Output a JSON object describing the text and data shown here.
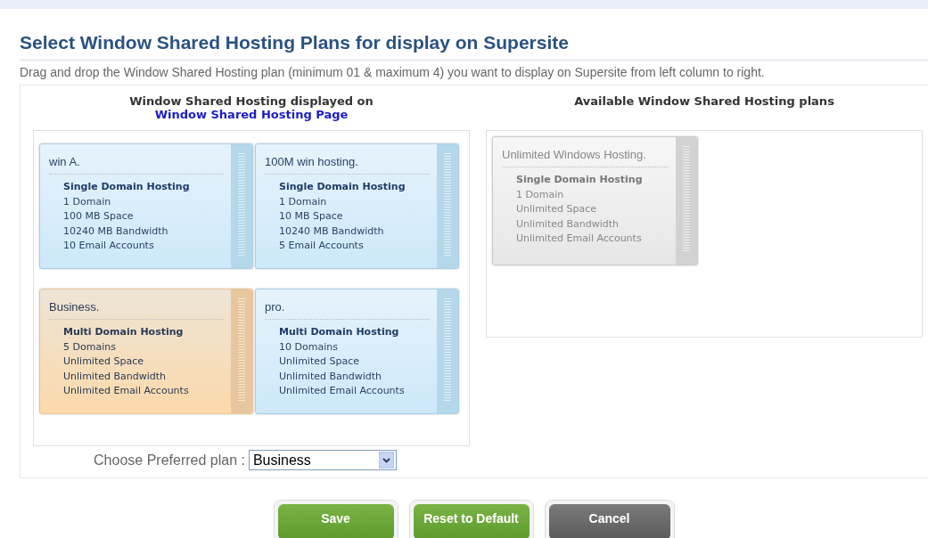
{
  "title": "Select Window Shared Hosting Plans for display on Supersite",
  "description": "Drag and drop the Window Shared Hosting plan (minimum 01 & maximum 4) you want to display on Supersite from left column to right.",
  "displayed": {
    "heading": "Window Shared Hosting displayed on",
    "heading_link": "Window Shared Hosting Page",
    "plans": [
      {
        "name": "win A.",
        "selected": false,
        "features": [
          "Single Domain Hosting",
          "1 Domain",
          "100 MB Space",
          "10240 MB Bandwidth",
          "10 Email Accounts"
        ]
      },
      {
        "name": "100M win hosting.",
        "selected": false,
        "features": [
          "Single Domain Hosting",
          "1 Domain",
          "10 MB Space",
          "10240 MB Bandwidth",
          "5 Email Accounts"
        ]
      },
      {
        "name": "Business.",
        "selected": true,
        "features": [
          "Multi Domain Hosting",
          "5 Domains",
          "Unlimited Space",
          "Unlimited Bandwidth",
          "Unlimited Email Accounts"
        ]
      },
      {
        "name": "pro.",
        "selected": false,
        "features": [
          "Multi Domain Hosting",
          "10 Domains",
          "Unlimited Space",
          "Unlimited Bandwidth",
          "Unlimited Email Accounts"
        ]
      }
    ]
  },
  "available": {
    "heading": "Available Window Shared Hosting plans",
    "plans": [
      {
        "name": "Unlimited Windows Hosting.",
        "features": [
          "Single Domain Hosting",
          "1 Domain",
          "Unlimited Space",
          "Unlimited Bandwidth",
          "Unlimited Email Accounts"
        ]
      }
    ]
  },
  "preferred": {
    "label": "Choose Preferred plan :",
    "value": "Business"
  },
  "buttons": [
    {
      "label": "Save",
      "kind": "primary"
    },
    {
      "label": "Reset to Default",
      "kind": "primary"
    },
    {
      "label": "Cancel",
      "kind": "secondary"
    }
  ]
}
